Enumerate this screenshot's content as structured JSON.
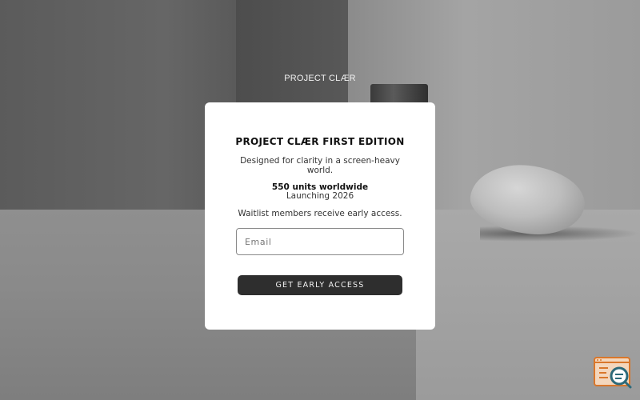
{
  "brand": {
    "logo_text": "PROJECT CLÆR"
  },
  "modal": {
    "title": "PROJECT CLÆR FIRST EDITION",
    "tagline": "Designed for clarity in a screen-heavy world.",
    "units": "550 units worldwide",
    "launch": "Launching 2026",
    "waitlist_note": "Waitlist members receive early access.",
    "email_placeholder": "Email",
    "email_value": "",
    "cta_label": "GET EARLY ACCESS"
  },
  "corner_widget": {
    "icon": "search-document-icon",
    "colors": {
      "frame": "#d9772b",
      "lens": "#2d6a7a"
    }
  },
  "colors": {
    "modal_bg": "#ffffff",
    "cta_bg": "#2e2e2e",
    "cta_text": "#f2f2f2",
    "title_text": "#111111"
  }
}
